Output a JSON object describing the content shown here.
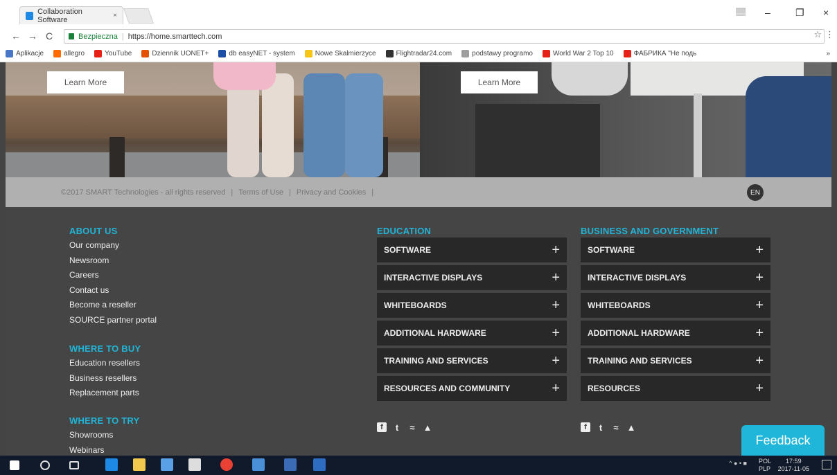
{
  "browser": {
    "tab_title": "Collaboration Software",
    "close_glyph": "×",
    "profile_badge": "▒▒",
    "win_minimize": "–",
    "win_restore": "❐",
    "win_close": "×",
    "back_glyph": "←",
    "forward_glyph": "→",
    "reload_glyph": "C",
    "secure_label": "Bezpieczna",
    "separator": "|",
    "url": "https://home.smarttech.com",
    "star_glyph": "☆",
    "menu_glyph": "⋮",
    "bookmarks": [
      {
        "label": "Aplikacje",
        "color": "#4a76c8"
      },
      {
        "label": "allegro",
        "color": "#ff6a00"
      },
      {
        "label": "YouTube",
        "color": "#e62117"
      },
      {
        "label": "Dziennik UONET+",
        "color": "#e65100"
      },
      {
        "label": "db easyNET - system",
        "color": "#1a4fa3"
      },
      {
        "label": "Nowe Skalmierzyce",
        "color": "#f5c518"
      },
      {
        "label": "Flightradar24.com",
        "color": "#333333"
      },
      {
        "label": "podstawy programo",
        "color": "#9e9e9e"
      },
      {
        "label": "World War 2 Top 10",
        "color": "#e62117"
      },
      {
        "label": "ФАБРИКА \"Не подь",
        "color": "#e62117"
      }
    ],
    "more_glyph": "»"
  },
  "hero": {
    "learn_more_left": "Learn More",
    "learn_more_right": "Learn More"
  },
  "copyright": {
    "text": "©2017 SMART Technologies - all rights reserved",
    "sep": "|",
    "terms": "Terms of Use",
    "privacy": "Privacy and Cookies",
    "lang": "EN"
  },
  "footer": {
    "about": {
      "heading": "ABOUT US",
      "links": [
        "Our company",
        "Newsroom",
        "Careers",
        "Contact us",
        "Become a reseller",
        "SOURCE partner portal"
      ]
    },
    "buy": {
      "heading": "WHERE TO BUY",
      "links": [
        "Education resellers",
        "Business resellers",
        "Replacement parts"
      ]
    },
    "try": {
      "heading": "WHERE TO TRY",
      "links": [
        "Showrooms",
        "Webinars"
      ]
    },
    "education": {
      "heading": "EDUCATION",
      "items": [
        "SOFTWARE",
        "INTERACTIVE DISPLAYS",
        "WHITEBOARDS",
        "ADDITIONAL HARDWARE",
        "TRAINING AND SERVICES",
        "RESOURCES AND COMMUNITY"
      ]
    },
    "business": {
      "heading": "BUSINESS AND GOVERNMENT",
      "items": [
        "SOFTWARE",
        "INTERACTIVE DISPLAYS",
        "WHITEBOARDS",
        "ADDITIONAL HARDWARE",
        "TRAINING AND SERVICES",
        "RESOURCES"
      ]
    },
    "plus": "+",
    "social": {
      "f": "f",
      "t": "t",
      "rss": "≈",
      "yt": "▲"
    }
  },
  "feedback": "Feedback",
  "taskbar": {
    "lang": "POL",
    "lang_sub": "PLP",
    "time": "17:59",
    "date": "2017-11-05",
    "tray": "^ ● • ■"
  }
}
